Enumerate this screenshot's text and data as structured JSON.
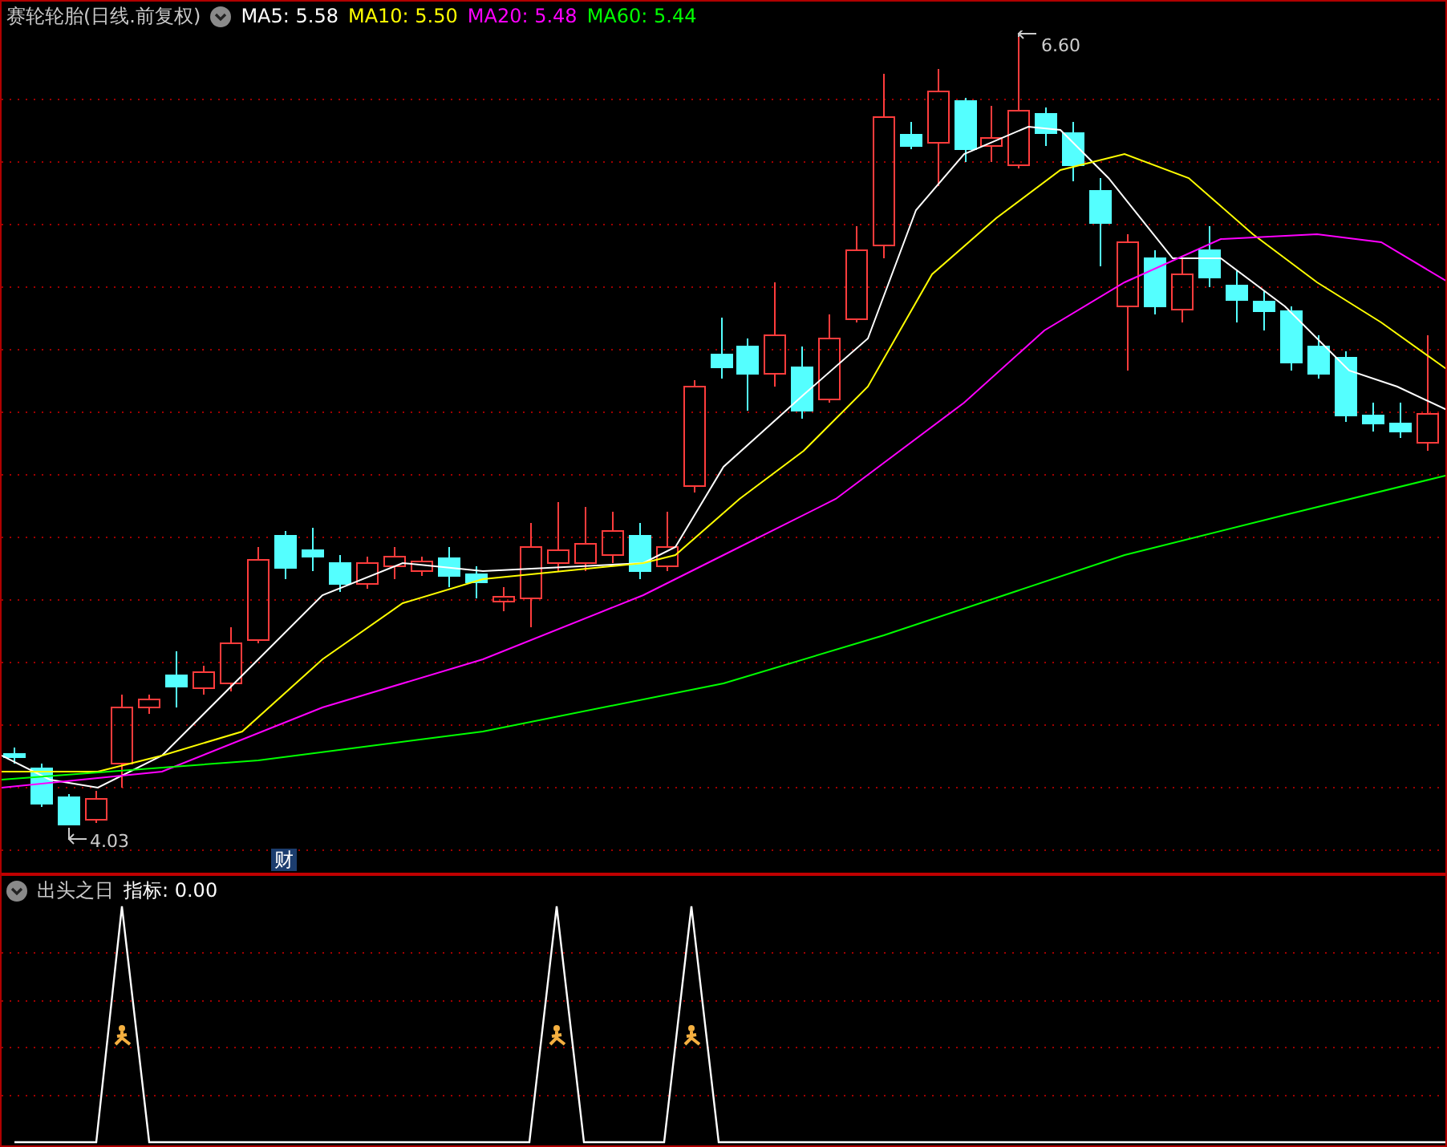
{
  "price_panel": {
    "stock_title": "赛轮轮胎(日线.前复权)",
    "moving_averages": [
      {
        "label": "MA5: 5.58",
        "color": "#ffffff"
      },
      {
        "label": "MA10: 5.50",
        "color": "#ffff00"
      },
      {
        "label": "MA20: 5.48",
        "color": "#ff00ff"
      },
      {
        "label": "MA60: 5.44",
        "color": "#00ff00"
      }
    ],
    "high_label": "6.60",
    "low_label": "4.03",
    "badge": "财"
  },
  "indicator_panel": {
    "name": "出头之日",
    "reading": "指标: 0.00"
  }
}
